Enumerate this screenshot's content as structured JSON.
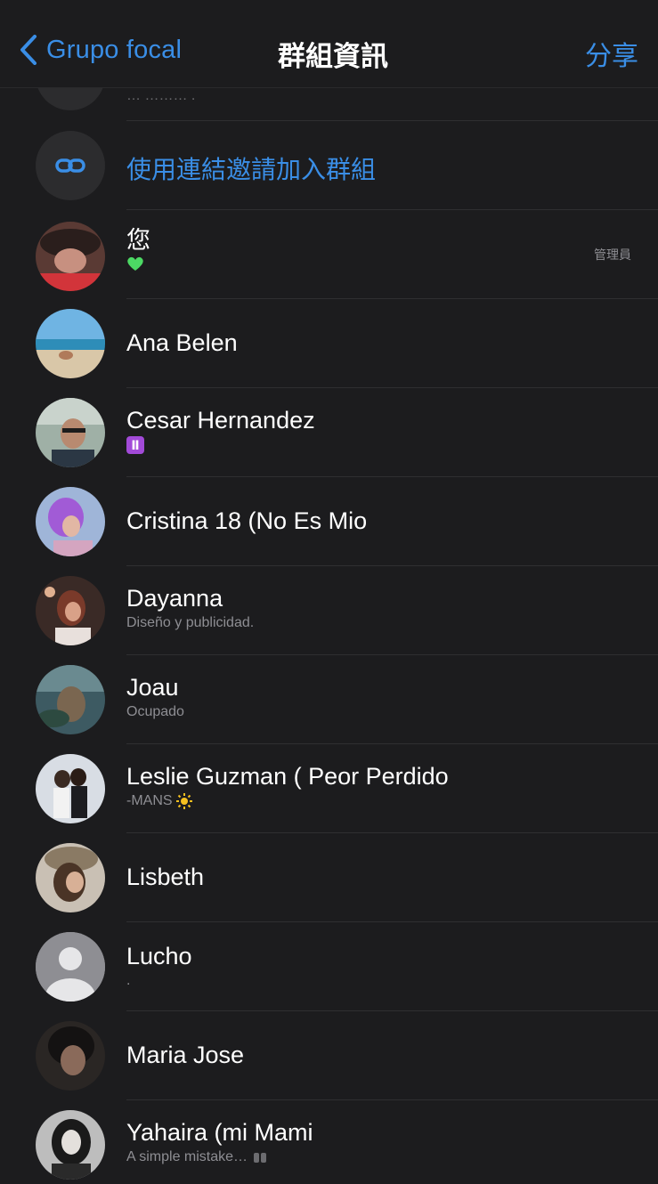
{
  "nav": {
    "back_label": "Grupo focal",
    "title": "群組資訊",
    "share_label": "分享"
  },
  "partial_row": {
    "sub": "… ……… ."
  },
  "invite_link": {
    "label": "使用連結邀請加入群組"
  },
  "members": [
    {
      "name": "您",
      "sub_icon": "green-heart-icon",
      "badge": "管理員"
    },
    {
      "name": "Ana Belen"
    },
    {
      "name": "Cesar Hernandez",
      "sub_icon": "gemini-icon"
    },
    {
      "name": "Cristina 18 (No Es Mio"
    },
    {
      "name": "Dayanna",
      "sub": "Diseño y publicidad."
    },
    {
      "name": "Joau",
      "sub": "Ocupado"
    },
    {
      "name": "Leslie Guzman ( Peor Perdido",
      "sub": "-MANS",
      "sub_icon": "sun-icon"
    },
    {
      "name": "Lisbeth"
    },
    {
      "name": "Lucho",
      "sub": "."
    },
    {
      "name": "Maria Jose"
    },
    {
      "name": "Yahaira (mi Mami",
      "sub": "A simple mistake…",
      "sub_icon": "hands-icon"
    }
  ],
  "colors": {
    "accent": "#3a8ee6",
    "background": "#1c1c1e",
    "secondary_text": "#8e8e93"
  }
}
